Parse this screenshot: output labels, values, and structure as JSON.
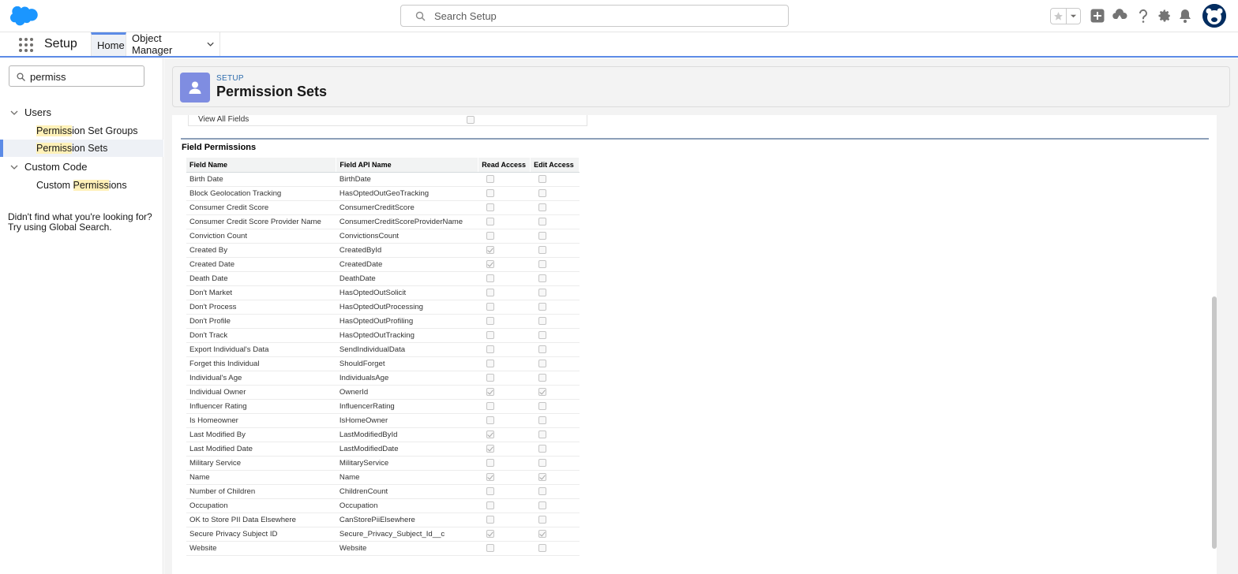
{
  "header": {
    "search_placeholder": "Search Setup",
    "icons": [
      "salesforce-cloud-logo",
      "star-icon",
      "chevron-down-icon",
      "add-icon",
      "trailhead-icon",
      "help-icon",
      "gear-icon",
      "bell-icon",
      "avatar"
    ]
  },
  "nav": {
    "app_name": "Setup",
    "tabs": [
      {
        "label": "Home",
        "active": true
      },
      {
        "label": "Object Manager",
        "active": false
      }
    ]
  },
  "sidebar": {
    "quick_find_value": "permiss",
    "groups": [
      {
        "label": "Users",
        "children": [
          {
            "hl": "Permiss",
            "rest": "ion Set Groups"
          },
          {
            "hl": "Permiss",
            "rest": "ion Sets"
          }
        ]
      },
      {
        "label": "Custom Code",
        "children": [
          {
            "pre": "Custom ",
            "hl": "Permiss",
            "rest": "ions"
          }
        ]
      }
    ],
    "not_found_1": "Didn't find what you're looking for?",
    "not_found_2": "Try using Global Search."
  },
  "page": {
    "eyebrow": "SETUP",
    "title": "Permission Sets"
  },
  "object_permission_row": {
    "label": "View All Fields",
    "checked": false
  },
  "field_permissions": {
    "section_title": "Field Permissions",
    "columns": [
      "Field Name",
      "Field API Name",
      "Read Access",
      "Edit Access"
    ],
    "rows": [
      {
        "name": "Birth Date",
        "api": "BirthDate",
        "read": false,
        "edit": false
      },
      {
        "name": "Block Geolocation Tracking",
        "api": "HasOptedOutGeoTracking",
        "read": false,
        "edit": false
      },
      {
        "name": "Consumer Credit Score",
        "api": "ConsumerCreditScore",
        "read": false,
        "edit": false
      },
      {
        "name": "Consumer Credit Score Provider Name",
        "api": "ConsumerCreditScoreProviderName",
        "read": false,
        "edit": false
      },
      {
        "name": "Conviction Count",
        "api": "ConvictionsCount",
        "read": false,
        "edit": false
      },
      {
        "name": "Created By",
        "api": "CreatedById",
        "read": true,
        "edit": false
      },
      {
        "name": "Created Date",
        "api": "CreatedDate",
        "read": true,
        "edit": false
      },
      {
        "name": "Death Date",
        "api": "DeathDate",
        "read": false,
        "edit": false
      },
      {
        "name": "Don't Market",
        "api": "HasOptedOutSolicit",
        "read": false,
        "edit": false
      },
      {
        "name": "Don't Process",
        "api": "HasOptedOutProcessing",
        "read": false,
        "edit": false
      },
      {
        "name": "Don't Profile",
        "api": "HasOptedOutProfiling",
        "read": false,
        "edit": false
      },
      {
        "name": "Don't Track",
        "api": "HasOptedOutTracking",
        "read": false,
        "edit": false
      },
      {
        "name": "Export Individual's Data",
        "api": "SendIndividualData",
        "read": false,
        "edit": false
      },
      {
        "name": "Forget this Individual",
        "api": "ShouldForget",
        "read": false,
        "edit": false
      },
      {
        "name": "Individual's Age",
        "api": "IndividualsAge",
        "read": false,
        "edit": false
      },
      {
        "name": "Individual Owner",
        "api": "OwnerId",
        "read": true,
        "edit": true
      },
      {
        "name": "Influencer Rating",
        "api": "InfluencerRating",
        "read": false,
        "edit": false
      },
      {
        "name": "Is Homeowner",
        "api": "IsHomeOwner",
        "read": false,
        "edit": false
      },
      {
        "name": "Last Modified By",
        "api": "LastModifiedById",
        "read": true,
        "edit": false
      },
      {
        "name": "Last Modified Date",
        "api": "LastModifiedDate",
        "read": true,
        "edit": false
      },
      {
        "name": "Military Service",
        "api": "MilitaryService",
        "read": false,
        "edit": false
      },
      {
        "name": "Name",
        "api": "Name",
        "read": true,
        "edit": true
      },
      {
        "name": "Number of Children",
        "api": "ChildrenCount",
        "read": false,
        "edit": false
      },
      {
        "name": "Occupation",
        "api": "Occupation",
        "read": false,
        "edit": false
      },
      {
        "name": "OK to Store PII Data Elsewhere",
        "api": "CanStorePiiElsewhere",
        "read": false,
        "edit": false
      },
      {
        "name": "Secure Privacy Subject ID",
        "api": "Secure_Privacy_Subject_Id__c",
        "read": true,
        "edit": true
      },
      {
        "name": "Website",
        "api": "Website",
        "read": false,
        "edit": false
      }
    ]
  },
  "colors": {
    "accent": "#5c8be6",
    "brand_cloud": "#1b96ff",
    "page_icon_bg": "#7f8de1",
    "highlight": "#fff1b8"
  }
}
